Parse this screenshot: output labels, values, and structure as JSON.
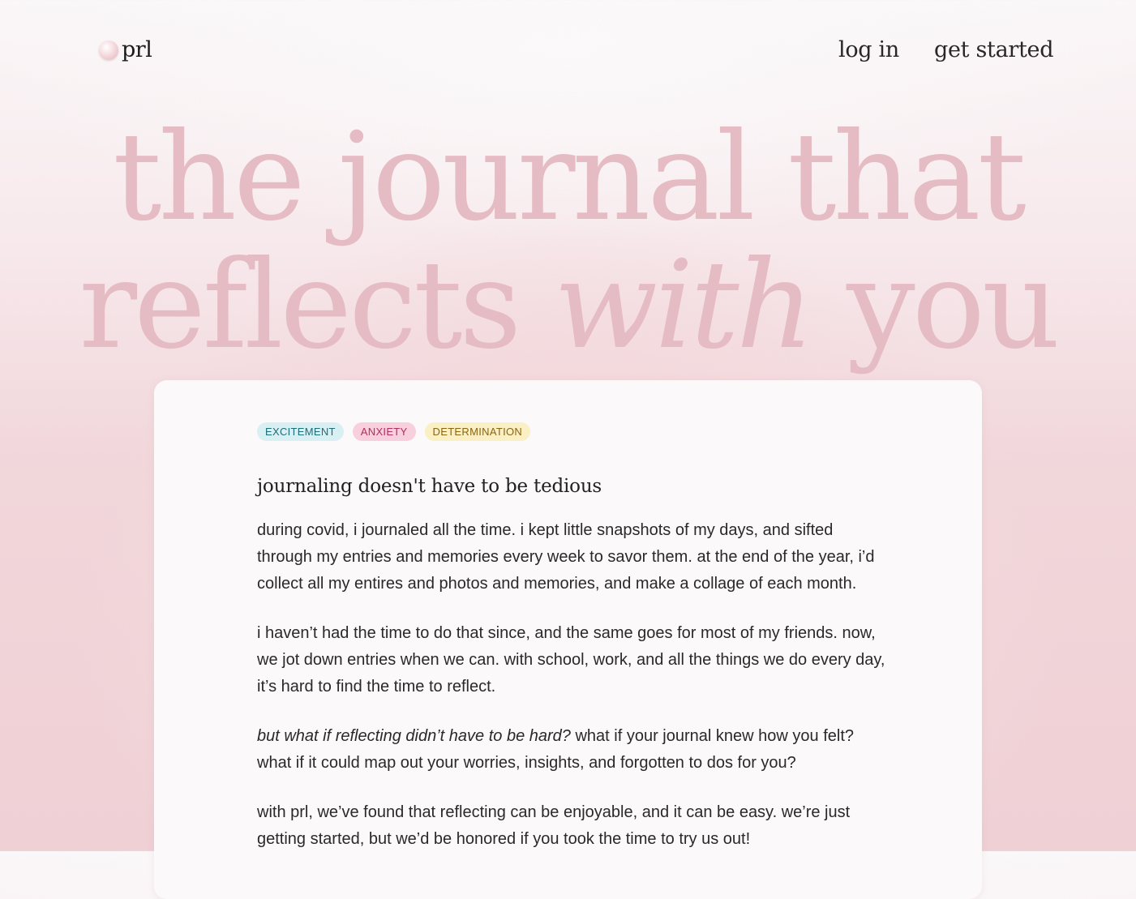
{
  "nav": {
    "logo_text": "prl",
    "login_label": "log in",
    "get_started_label": "get started"
  },
  "hero": {
    "line1": "the journal that",
    "line2_prefix": "reflects ",
    "line2_emphasis": "with",
    "line2_suffix": " you"
  },
  "card": {
    "tags": [
      {
        "label": "EXCITEMENT",
        "color": "#1e6d78",
        "bg": "#d8f0f3"
      },
      {
        "label": "ANXIETY",
        "color": "#b0305f",
        "bg": "#f8cfdc"
      },
      {
        "label": "DETERMINATION",
        "color": "#8a6514",
        "bg": "#fbefc4"
      }
    ],
    "title": "journaling doesn't have to be tedious",
    "paragraphs": {
      "p1": "during covid, i journaled all the time. i kept little snapshots of my days, and sifted through my entries and memories every week to savor them. at the end of the year, i’d collect all my entires and photos and memories, and make a collage of each month.",
      "p2": "i haven’t had the time to do that since, and the same goes for most of my friends. now, we jot down entries when we can. with school, work, and all the things we do every day, it’s hard to find the time to reflect.",
      "p3_italic": "but what if reflecting didn’t have to be hard?",
      "p3_rest": " what if your journal knew how you felt? what if it could map out your worries, insights, and forgotten to dos for you?",
      "p4": "with prl, we’ve found that reflecting can be enjoyable, and it can be easy. we’re just getting started, but we’d be honored if you took the time to try us out!"
    }
  },
  "colors": {
    "hero_text": "#e6bcc4",
    "background_pink": "#efd0d5",
    "card_bg": "#fbf9fa"
  }
}
